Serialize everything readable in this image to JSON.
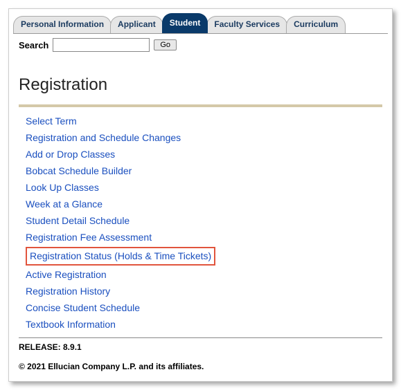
{
  "tabs": [
    {
      "label": "Personal Information",
      "active": false
    },
    {
      "label": "Applicant",
      "active": false
    },
    {
      "label": "Student",
      "active": true
    },
    {
      "label": "Faculty Services",
      "active": false
    },
    {
      "label": "Curriculum",
      "active": false
    }
  ],
  "search": {
    "label": "Search",
    "value": "",
    "go_label": "Go"
  },
  "page_title": "Registration",
  "links": [
    {
      "label": "Select Term",
      "highlighted": false
    },
    {
      "label": "Registration and Schedule Changes",
      "highlighted": false
    },
    {
      "label": "Add or Drop Classes",
      "highlighted": false
    },
    {
      "label": "Bobcat Schedule Builder",
      "highlighted": false
    },
    {
      "label": "Look Up Classes",
      "highlighted": false
    },
    {
      "label": "Week at a Glance",
      "highlighted": false
    },
    {
      "label": "Student Detail Schedule",
      "highlighted": false
    },
    {
      "label": "Registration Fee Assessment",
      "highlighted": false
    },
    {
      "label": "Registration Status (Holds & Time Tickets)",
      "highlighted": true
    },
    {
      "label": "Active Registration",
      "highlighted": false
    },
    {
      "label": "Registration History",
      "highlighted": false
    },
    {
      "label": "Concise Student Schedule",
      "highlighted": false
    },
    {
      "label": "Textbook Information",
      "highlighted": false
    }
  ],
  "release": "RELEASE: 8.9.1",
  "copyright": "© 2021 Ellucian Company L.P. and its affiliates."
}
